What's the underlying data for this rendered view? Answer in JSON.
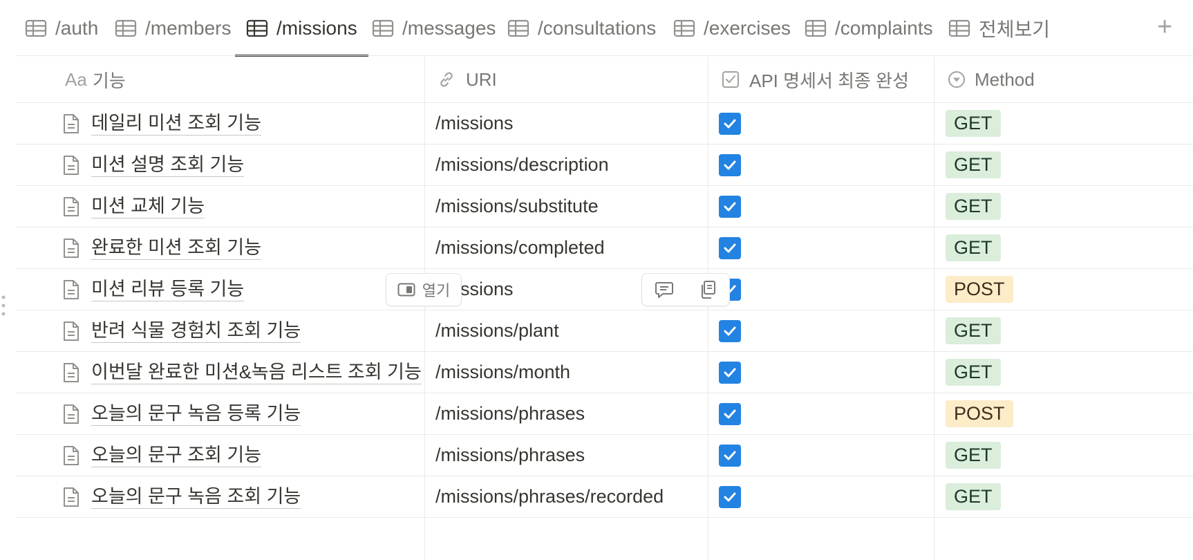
{
  "tabs": [
    {
      "label": "/auth",
      "active": false
    },
    {
      "label": "/members",
      "active": false
    },
    {
      "label": "/missions",
      "active": true
    },
    {
      "label": "/messages",
      "active": false
    },
    {
      "label": "/consultations",
      "active": false
    },
    {
      "label": "/exercises",
      "active": false
    },
    {
      "label": "/complaints",
      "active": false
    },
    {
      "label": "전체보기",
      "active": false
    }
  ],
  "add_tab_label": "+",
  "columns": {
    "name": {
      "icon": "Aa",
      "label": "기능"
    },
    "uri": {
      "label": "URI"
    },
    "api_complete": {
      "label": "API 명세서 최종 완성"
    },
    "method": {
      "label": "Method"
    }
  },
  "rows": [
    {
      "name": "데일리 미션 조회 기능",
      "uri": "/missions",
      "checked": true,
      "method": "GET"
    },
    {
      "name": "미션 설명 조회 기능",
      "uri": "/missions/description",
      "checked": true,
      "method": "GET"
    },
    {
      "name": "미션 교체 기능",
      "uri": "/missions/substitute",
      "checked": true,
      "method": "GET"
    },
    {
      "name": "완료한 미션 조회 기능",
      "uri": "/missions/completed",
      "checked": true,
      "method": "GET"
    },
    {
      "name": "미션 리뷰 등록 기능",
      "uri": "/missions",
      "checked": true,
      "method": "POST"
    },
    {
      "name": "반려 식물 경험치 조회 기능",
      "uri": "/missions/plant",
      "checked": true,
      "method": "GET"
    },
    {
      "name": "이번달 완료한 미션&녹음 리스트 조회 기능",
      "uri": "/missions/month",
      "checked": true,
      "method": "GET"
    },
    {
      "name": "오늘의 문구 녹음 등록 기능",
      "uri": "/missions/phrases",
      "checked": true,
      "method": "POST"
    },
    {
      "name": "오늘의 문구 조회 기능",
      "uri": "/missions/phrases",
      "checked": true,
      "method": "GET"
    },
    {
      "name": "오늘의 문구 녹음 조회 기능",
      "uri": "/missions/phrases/recorded",
      "checked": true,
      "method": "GET"
    }
  ],
  "hover": {
    "open_label": "열기"
  },
  "colors": {
    "accent": "#2383e2",
    "get_badge": "#dbeddb",
    "post_badge": "#fdecc8"
  }
}
